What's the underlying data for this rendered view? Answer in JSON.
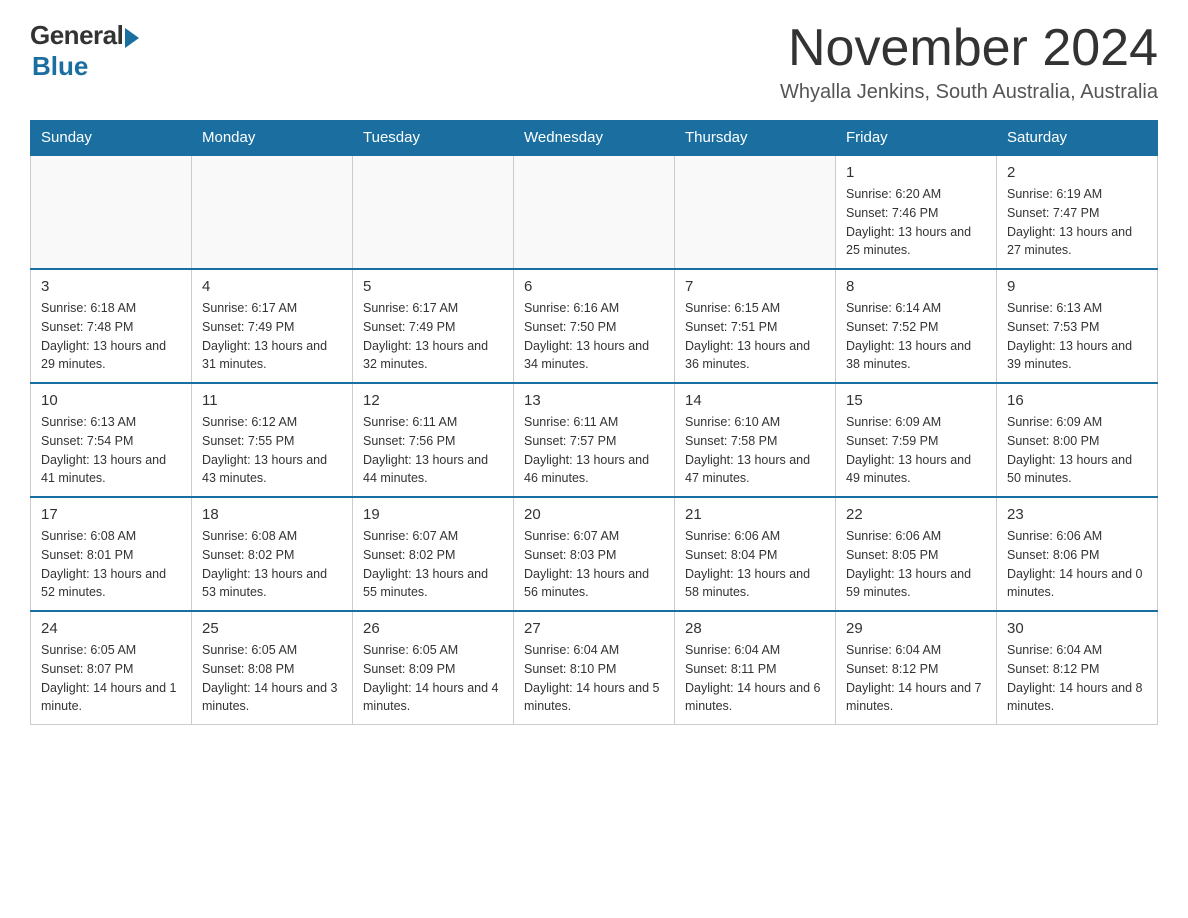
{
  "logo": {
    "general": "General",
    "blue": "Blue"
  },
  "title": "November 2024",
  "subtitle": "Whyalla Jenkins, South Australia, Australia",
  "days_of_week": [
    "Sunday",
    "Monday",
    "Tuesday",
    "Wednesday",
    "Thursday",
    "Friday",
    "Saturday"
  ],
  "weeks": [
    [
      {
        "day": "",
        "info": ""
      },
      {
        "day": "",
        "info": ""
      },
      {
        "day": "",
        "info": ""
      },
      {
        "day": "",
        "info": ""
      },
      {
        "day": "",
        "info": ""
      },
      {
        "day": "1",
        "info": "Sunrise: 6:20 AM\nSunset: 7:46 PM\nDaylight: 13 hours and 25 minutes."
      },
      {
        "day": "2",
        "info": "Sunrise: 6:19 AM\nSunset: 7:47 PM\nDaylight: 13 hours and 27 minutes."
      }
    ],
    [
      {
        "day": "3",
        "info": "Sunrise: 6:18 AM\nSunset: 7:48 PM\nDaylight: 13 hours and 29 minutes."
      },
      {
        "day": "4",
        "info": "Sunrise: 6:17 AM\nSunset: 7:49 PM\nDaylight: 13 hours and 31 minutes."
      },
      {
        "day": "5",
        "info": "Sunrise: 6:17 AM\nSunset: 7:49 PM\nDaylight: 13 hours and 32 minutes."
      },
      {
        "day": "6",
        "info": "Sunrise: 6:16 AM\nSunset: 7:50 PM\nDaylight: 13 hours and 34 minutes."
      },
      {
        "day": "7",
        "info": "Sunrise: 6:15 AM\nSunset: 7:51 PM\nDaylight: 13 hours and 36 minutes."
      },
      {
        "day": "8",
        "info": "Sunrise: 6:14 AM\nSunset: 7:52 PM\nDaylight: 13 hours and 38 minutes."
      },
      {
        "day": "9",
        "info": "Sunrise: 6:13 AM\nSunset: 7:53 PM\nDaylight: 13 hours and 39 minutes."
      }
    ],
    [
      {
        "day": "10",
        "info": "Sunrise: 6:13 AM\nSunset: 7:54 PM\nDaylight: 13 hours and 41 minutes."
      },
      {
        "day": "11",
        "info": "Sunrise: 6:12 AM\nSunset: 7:55 PM\nDaylight: 13 hours and 43 minutes."
      },
      {
        "day": "12",
        "info": "Sunrise: 6:11 AM\nSunset: 7:56 PM\nDaylight: 13 hours and 44 minutes."
      },
      {
        "day": "13",
        "info": "Sunrise: 6:11 AM\nSunset: 7:57 PM\nDaylight: 13 hours and 46 minutes."
      },
      {
        "day": "14",
        "info": "Sunrise: 6:10 AM\nSunset: 7:58 PM\nDaylight: 13 hours and 47 minutes."
      },
      {
        "day": "15",
        "info": "Sunrise: 6:09 AM\nSunset: 7:59 PM\nDaylight: 13 hours and 49 minutes."
      },
      {
        "day": "16",
        "info": "Sunrise: 6:09 AM\nSunset: 8:00 PM\nDaylight: 13 hours and 50 minutes."
      }
    ],
    [
      {
        "day": "17",
        "info": "Sunrise: 6:08 AM\nSunset: 8:01 PM\nDaylight: 13 hours and 52 minutes."
      },
      {
        "day": "18",
        "info": "Sunrise: 6:08 AM\nSunset: 8:02 PM\nDaylight: 13 hours and 53 minutes."
      },
      {
        "day": "19",
        "info": "Sunrise: 6:07 AM\nSunset: 8:02 PM\nDaylight: 13 hours and 55 minutes."
      },
      {
        "day": "20",
        "info": "Sunrise: 6:07 AM\nSunset: 8:03 PM\nDaylight: 13 hours and 56 minutes."
      },
      {
        "day": "21",
        "info": "Sunrise: 6:06 AM\nSunset: 8:04 PM\nDaylight: 13 hours and 58 minutes."
      },
      {
        "day": "22",
        "info": "Sunrise: 6:06 AM\nSunset: 8:05 PM\nDaylight: 13 hours and 59 minutes."
      },
      {
        "day": "23",
        "info": "Sunrise: 6:06 AM\nSunset: 8:06 PM\nDaylight: 14 hours and 0 minutes."
      }
    ],
    [
      {
        "day": "24",
        "info": "Sunrise: 6:05 AM\nSunset: 8:07 PM\nDaylight: 14 hours and 1 minute."
      },
      {
        "day": "25",
        "info": "Sunrise: 6:05 AM\nSunset: 8:08 PM\nDaylight: 14 hours and 3 minutes."
      },
      {
        "day": "26",
        "info": "Sunrise: 6:05 AM\nSunset: 8:09 PM\nDaylight: 14 hours and 4 minutes."
      },
      {
        "day": "27",
        "info": "Sunrise: 6:04 AM\nSunset: 8:10 PM\nDaylight: 14 hours and 5 minutes."
      },
      {
        "day": "28",
        "info": "Sunrise: 6:04 AM\nSunset: 8:11 PM\nDaylight: 14 hours and 6 minutes."
      },
      {
        "day": "29",
        "info": "Sunrise: 6:04 AM\nSunset: 8:12 PM\nDaylight: 14 hours and 7 minutes."
      },
      {
        "day": "30",
        "info": "Sunrise: 6:04 AM\nSunset: 8:12 PM\nDaylight: 14 hours and 8 minutes."
      }
    ]
  ]
}
